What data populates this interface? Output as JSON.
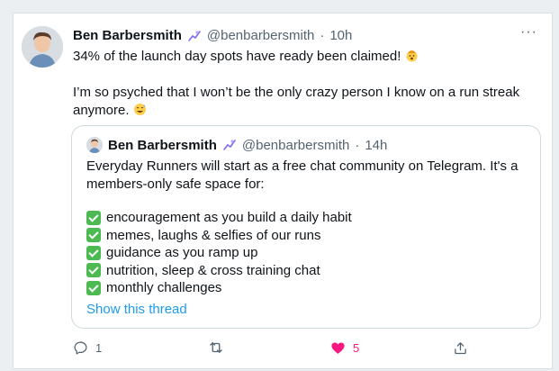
{
  "tweet": {
    "author_name": "Ben Barbersmith",
    "handle": "@benbarbersmith",
    "separator": "·",
    "time": "10h",
    "more_label": "···",
    "text_line1": "34% of the launch day spots have ready been claimed! ",
    "text_line2": "I’m so psyched that I won’t be the only crazy person I know on a run streak anymore. "
  },
  "quote": {
    "author_name": "Ben Barbersmith",
    "handle": "@benbarbersmith",
    "separator": "·",
    "time": "14h",
    "body": "Everyday Runners will start as a free chat community on Telegram. It's a members-only safe space for:",
    "bullets": [
      "encouragement as you build a daily habit",
      "memes, laughs & selfies of our runs",
      "guidance as you ramp up",
      "nutrition, sleep & cross training chat",
      "monthly challenges"
    ],
    "show_thread": "Show this thread"
  },
  "actions": {
    "reply_count": "1",
    "retweet_count": "",
    "like_count": "5"
  },
  "colors": {
    "accent": "#1d9bf0",
    "like": "#f91880",
    "check": "#4cba51",
    "verified": "#7b6cf6"
  }
}
